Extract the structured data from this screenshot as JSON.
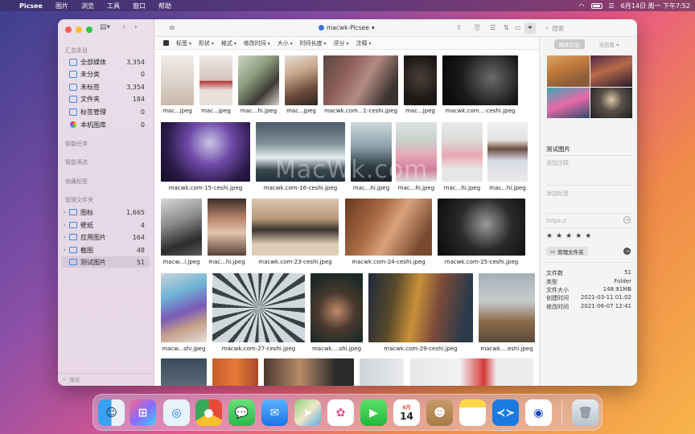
{
  "menubar": {
    "app_name": "Picsee",
    "items": [
      "图片",
      "浏览",
      "工具",
      "窗口",
      "帮助"
    ],
    "datetime": "6月14日 周一 下午7:52"
  },
  "toolbar": {
    "title": "macwk-Picsee",
    "search_placeholder": "搜索"
  },
  "sidebar": {
    "section_summary": "汇总条目",
    "items": [
      {
        "label": "全部媒体",
        "count": "3,354"
      },
      {
        "label": "未分类",
        "count": "0"
      },
      {
        "label": "未标签",
        "count": "3,354"
      },
      {
        "label": "文件夹",
        "count": "184"
      },
      {
        "label": "标签管理",
        "count": "0"
      },
      {
        "label": "本机图库",
        "count": "0"
      }
    ],
    "section_smart_tasks": "智能任务",
    "section_smart_filter": "智能筛选",
    "section_favorites": "收藏标签",
    "section_folders": "管理文件夹",
    "folders": [
      {
        "label": "图标",
        "count": "1,665"
      },
      {
        "label": "壁纸",
        "count": "4"
      },
      {
        "label": "应用图片",
        "count": "164"
      },
      {
        "label": "截图",
        "count": "48"
      },
      {
        "label": "测试图片",
        "count": "51"
      }
    ],
    "search_placeholder": "搜索"
  },
  "filterbar": [
    "标签",
    "形状",
    "格式",
    "修改时间",
    "大小",
    "时间长度",
    "评分",
    "注释"
  ],
  "grid": {
    "captions": [
      "mac...jpeg",
      "mac...jpeg",
      "mac...hi.jpeg",
      "mac...jpeg",
      "macwk.com...1-ceshi.jpeg",
      "mac...jpeg",
      "macwk.com...-ceshi.jpeg",
      "macwk.com-15-ceshi.jpeg",
      "macwk.com-16-ceshi.jpeg",
      "mac...hi.jpeg",
      "mac...hi.jpeg",
      "mac...hi.jpeg",
      "mac...hi.jpeg",
      "macw...i.jpeg",
      "mac...hi.jpeg",
      "macwk.com-23-ceshi.jpeg",
      "macwk.com-24-ceshi.jpeg",
      "macwk.com-25-ceshi.jpeg",
      "macw...shi.jpeg",
      "macwk.com-27-ceshi.jpeg",
      "macwk....shi.jpeg",
      "macwk.com-29-ceshi.jpeg",
      "macwk....eshi.jpeg"
    ],
    "watermark": "MacWk.com"
  },
  "inspector": {
    "tab_media": "媒体信息",
    "tab_meta": "元信息",
    "name": "测试图片",
    "add_note": "添加注释",
    "add_tag": "添加标签",
    "url_placeholder": "https://",
    "stars": "★★★★★",
    "manage_button": "管理文件夹",
    "meta": [
      {
        "k": "文件数",
        "v": "51"
      },
      {
        "k": "类型",
        "v": "Folder"
      },
      {
        "k": "文件大小",
        "v": "148.91MB"
      },
      {
        "k": "创建时间",
        "v": "2021-03-11 01:02"
      },
      {
        "k": "修改时间",
        "v": "2021-06-07 12:41"
      }
    ]
  },
  "dock": {
    "calendar_month": "6月",
    "calendar_day": "14"
  }
}
